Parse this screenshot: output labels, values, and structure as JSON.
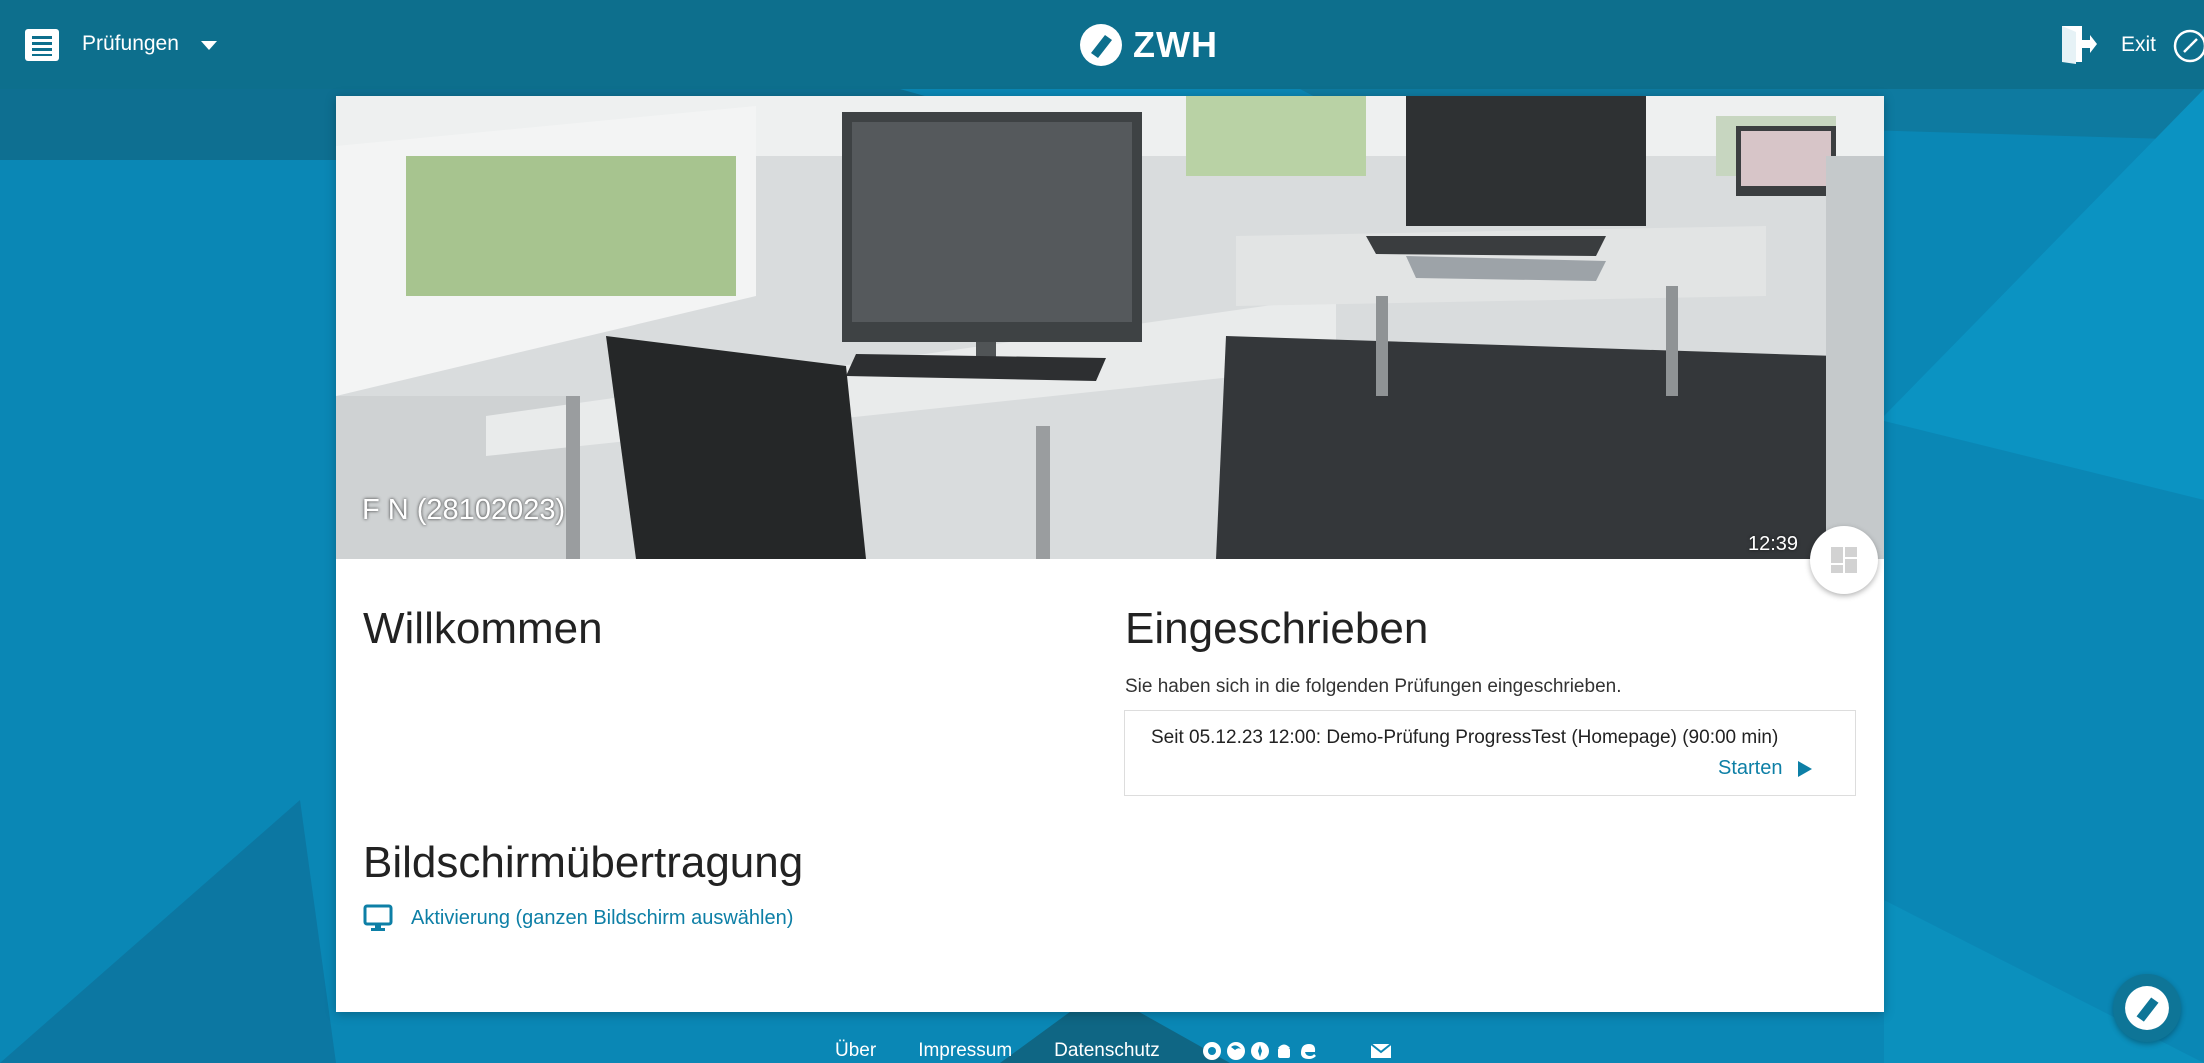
{
  "header": {
    "menu_label": "Prüfungen",
    "brand": "ZWH",
    "exit_label": "Exit"
  },
  "hero": {
    "user": "F N (28102023)",
    "time": "12:39"
  },
  "welcome": {
    "title": "Willkommen"
  },
  "enrolled": {
    "title": "Eingeschrieben",
    "description": "Sie haben sich in die folgenden Prüfungen eingeschrieben.",
    "exams": [
      {
        "text": "Seit 05.12.23 12:00: Demo-Prüfung ProgressTest (Homepage) (90:00 min)",
        "action": "Starten"
      }
    ]
  },
  "screen_share": {
    "title": "Bildschirmübertragung",
    "link": "Aktivierung (ganzen Bildschirm auswählen)"
  },
  "footer": {
    "links": [
      "Über",
      "Impressum",
      "Datenschutz"
    ]
  },
  "colors": {
    "header": "#0d6f8d",
    "background": "#0a87b5",
    "link": "#0d7fa6"
  }
}
